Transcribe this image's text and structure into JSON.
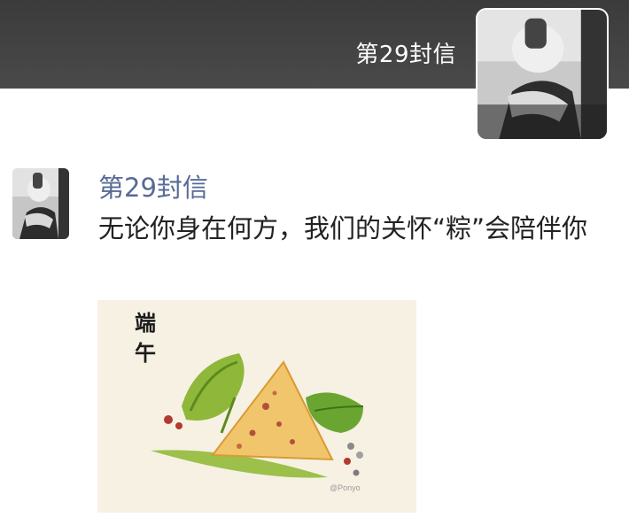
{
  "header": {
    "name": "第29封信"
  },
  "post": {
    "author": "第29封信",
    "text": "无论你身在何方，我们的关怀“粽”会陪伴你",
    "image": {
      "caption_line1": "端",
      "caption_line2": "午",
      "watermark": "@Ponyo"
    }
  },
  "colors": {
    "header_background": "#444444",
    "author_name": "#576b95",
    "text": "#222222",
    "image_background": "#f6f1e3"
  }
}
